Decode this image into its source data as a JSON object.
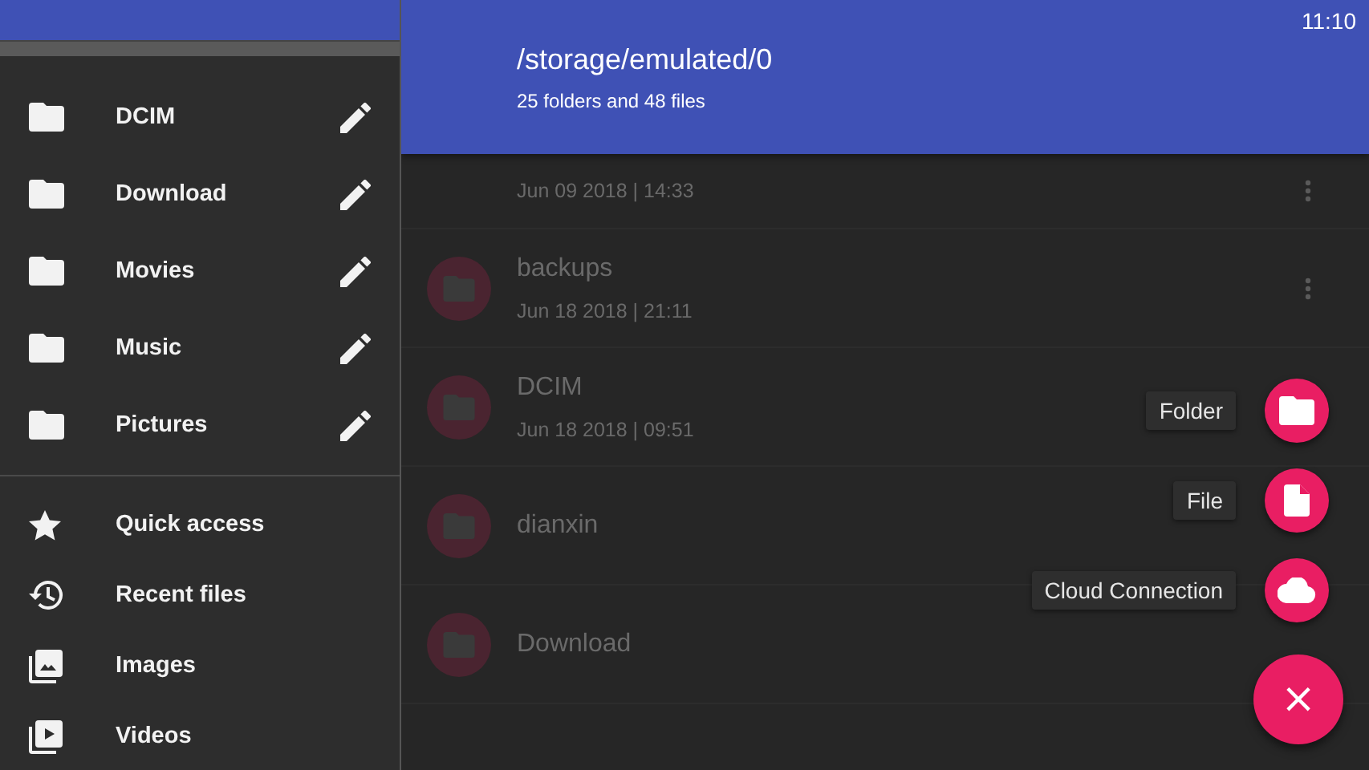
{
  "status_bar": {
    "time": "11:10"
  },
  "drawer": {
    "bookmarks": [
      {
        "kind": "folder",
        "label": "DCIM"
      },
      {
        "kind": "folder",
        "label": "Download"
      },
      {
        "kind": "folder",
        "label": "Movies"
      },
      {
        "kind": "folder",
        "label": "Music"
      },
      {
        "kind": "folder",
        "label": "Pictures"
      }
    ],
    "items": [
      {
        "kind": "star",
        "label": "Quick access"
      },
      {
        "kind": "history",
        "label": "Recent files"
      },
      {
        "kind": "images",
        "label": "Images"
      },
      {
        "kind": "video",
        "label": "Videos"
      }
    ]
  },
  "header": {
    "path": "/storage/emulated/0",
    "summary": "25 folders and 48 files"
  },
  "files": [
    {
      "date": "Jun 09 2018 | 14:33",
      "menu_icon": true
    },
    {
      "name": "backups",
      "date": "Jun 18 2018 | 21:11",
      "menu_icon": true
    },
    {
      "name": "DCIM",
      "date": "Jun 18 2018 | 09:51"
    },
    {
      "name": "dianxin"
    },
    {
      "name": "Download"
    }
  ],
  "fab_menu": {
    "actions": [
      {
        "kind": "folder",
        "label": "Folder"
      },
      {
        "kind": "file",
        "label": "File"
      },
      {
        "kind": "cloud",
        "label": "Cloud Connection"
      }
    ],
    "close": "×"
  }
}
